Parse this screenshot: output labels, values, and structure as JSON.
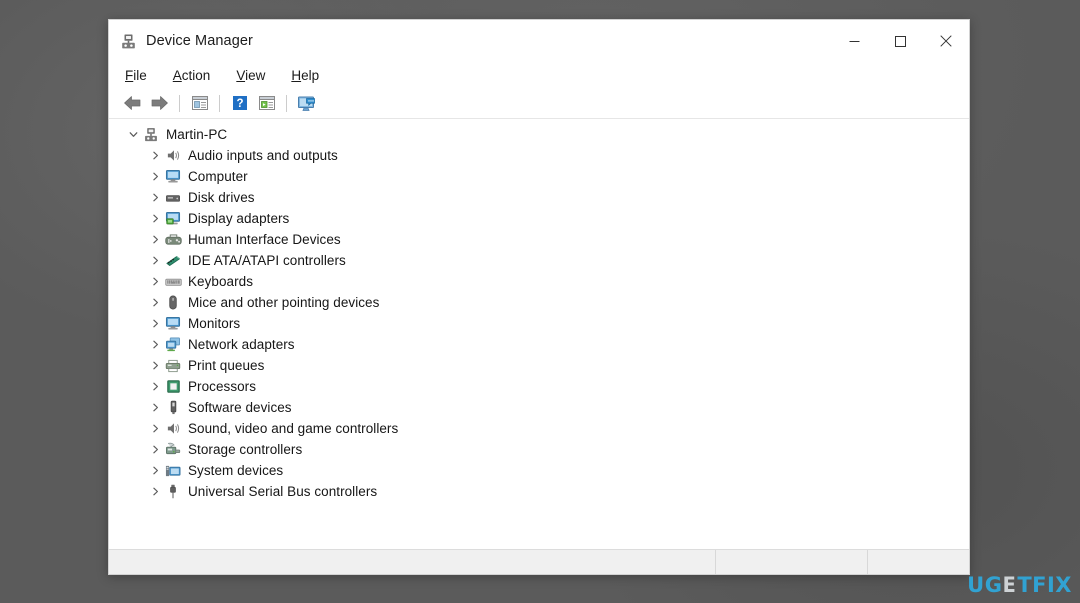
{
  "window": {
    "title": "Device Manager",
    "app_icon": "device-manager-icon",
    "controls": {
      "minimize": "─",
      "maximize": "□",
      "close": "✕"
    }
  },
  "menubar": {
    "items": [
      {
        "label": "File",
        "accel": "F",
        "rest": "ile"
      },
      {
        "label": "Action",
        "accel": "A",
        "rest": "ction"
      },
      {
        "label": "View",
        "accel": "V",
        "rest": "iew"
      },
      {
        "label": "Help",
        "accel": "H",
        "rest": "elp"
      }
    ]
  },
  "toolbar": {
    "buttons": [
      {
        "name": "back-button",
        "icon": "back-arrow-icon",
        "tooltip": "Back"
      },
      {
        "name": "forward-button",
        "icon": "forward-arrow-icon",
        "tooltip": "Forward"
      },
      {
        "name": "properties-button",
        "icon": "properties-icon",
        "tooltip": "Properties"
      },
      {
        "name": "help-button",
        "icon": "help-question-icon",
        "tooltip": "Help"
      },
      {
        "name": "update-driver-button",
        "icon": "update-driver-icon",
        "tooltip": "Update driver"
      },
      {
        "name": "scan-hardware-button",
        "icon": "scan-hardware-icon",
        "tooltip": "Scan for hardware changes"
      }
    ]
  },
  "tree": {
    "root": {
      "label": "Martin-PC",
      "icon": "computer-node-icon",
      "expanded": true,
      "chevron": "expanded-chevron-icon"
    },
    "items": [
      {
        "label": "Audio inputs and outputs",
        "icon": "speaker-icon",
        "chevron": "collapsed-chevron-icon"
      },
      {
        "label": "Computer",
        "icon": "monitor-icon",
        "chevron": "collapsed-chevron-icon"
      },
      {
        "label": "Disk drives",
        "icon": "disk-drive-icon",
        "chevron": "collapsed-chevron-icon"
      },
      {
        "label": "Display adapters",
        "icon": "display-adapter-icon",
        "chevron": "collapsed-chevron-icon"
      },
      {
        "label": "Human Interface Devices",
        "icon": "hid-icon",
        "chevron": "collapsed-chevron-icon"
      },
      {
        "label": "IDE ATA/ATAPI controllers",
        "icon": "ide-controller-icon",
        "chevron": "collapsed-chevron-icon"
      },
      {
        "label": "Keyboards",
        "icon": "keyboard-icon",
        "chevron": "collapsed-chevron-icon"
      },
      {
        "label": "Mice and other pointing devices",
        "icon": "mouse-icon",
        "chevron": "collapsed-chevron-icon"
      },
      {
        "label": "Monitors",
        "icon": "monitor-icon",
        "chevron": "collapsed-chevron-icon"
      },
      {
        "label": "Network adapters",
        "icon": "network-adapter-icon",
        "chevron": "collapsed-chevron-icon"
      },
      {
        "label": "Print queues",
        "icon": "printer-icon",
        "chevron": "collapsed-chevron-icon"
      },
      {
        "label": "Processors",
        "icon": "processor-icon",
        "chevron": "collapsed-chevron-icon"
      },
      {
        "label": "Software devices",
        "icon": "software-device-icon",
        "chevron": "collapsed-chevron-icon"
      },
      {
        "label": "Sound, video and game controllers",
        "icon": "speaker-icon",
        "chevron": "collapsed-chevron-icon"
      },
      {
        "label": "Storage controllers",
        "icon": "storage-controller-icon",
        "chevron": "collapsed-chevron-icon"
      },
      {
        "label": "System devices",
        "icon": "system-device-icon",
        "chevron": "collapsed-chevron-icon"
      },
      {
        "label": "Universal Serial Bus controllers",
        "icon": "usb-icon",
        "chevron": "collapsed-chevron-icon"
      }
    ]
  },
  "statusbar": {
    "pane1": "",
    "pane2": "",
    "pane3": ""
  },
  "watermark": {
    "part1": "UG",
    "part2": "E",
    "part3": "TFIX",
    "full": "UGETFIX",
    "color_accent": "#2ea9dd",
    "color_light": "#d9dde0"
  },
  "colors": {
    "desktop_background": "#5b5b5b",
    "window_background": "#ffffff",
    "statusbar_background": "#f0f0f0",
    "text": "#161616",
    "accent_blue": "#2ea9dd"
  }
}
